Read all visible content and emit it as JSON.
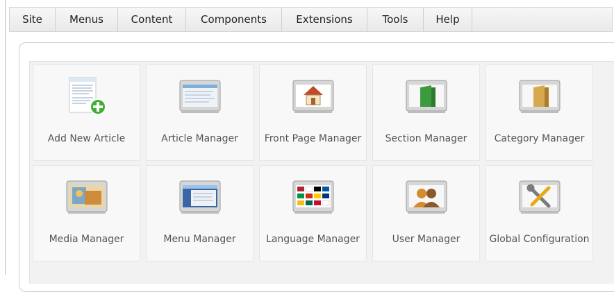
{
  "menu": [
    {
      "label": "Site",
      "width": 66
    },
    {
      "label": "Menus",
      "width": 90
    },
    {
      "label": "Content",
      "width": 98
    },
    {
      "label": "Components",
      "width": 138
    },
    {
      "label": "Extensions",
      "width": 123
    },
    {
      "label": "Tools",
      "width": 81
    },
    {
      "label": "Help",
      "width": 70
    }
  ],
  "tiles": [
    {
      "label": "Add New Article",
      "icon": "add-article-icon"
    },
    {
      "label": "Article Manager",
      "icon": "article-manager-icon"
    },
    {
      "label": "Front Page Manager",
      "icon": "front-page-icon"
    },
    {
      "label": "Section Manager",
      "icon": "section-icon"
    },
    {
      "label": "Category Manager",
      "icon": "category-icon"
    },
    {
      "label": "Media Manager",
      "icon": "media-icon"
    },
    {
      "label": "Menu Manager",
      "icon": "menu-manager-icon"
    },
    {
      "label": "Language Manager",
      "icon": "language-icon"
    },
    {
      "label": "User Manager",
      "icon": "user-icon"
    },
    {
      "label": "Global Configuration",
      "icon": "config-icon"
    }
  ]
}
